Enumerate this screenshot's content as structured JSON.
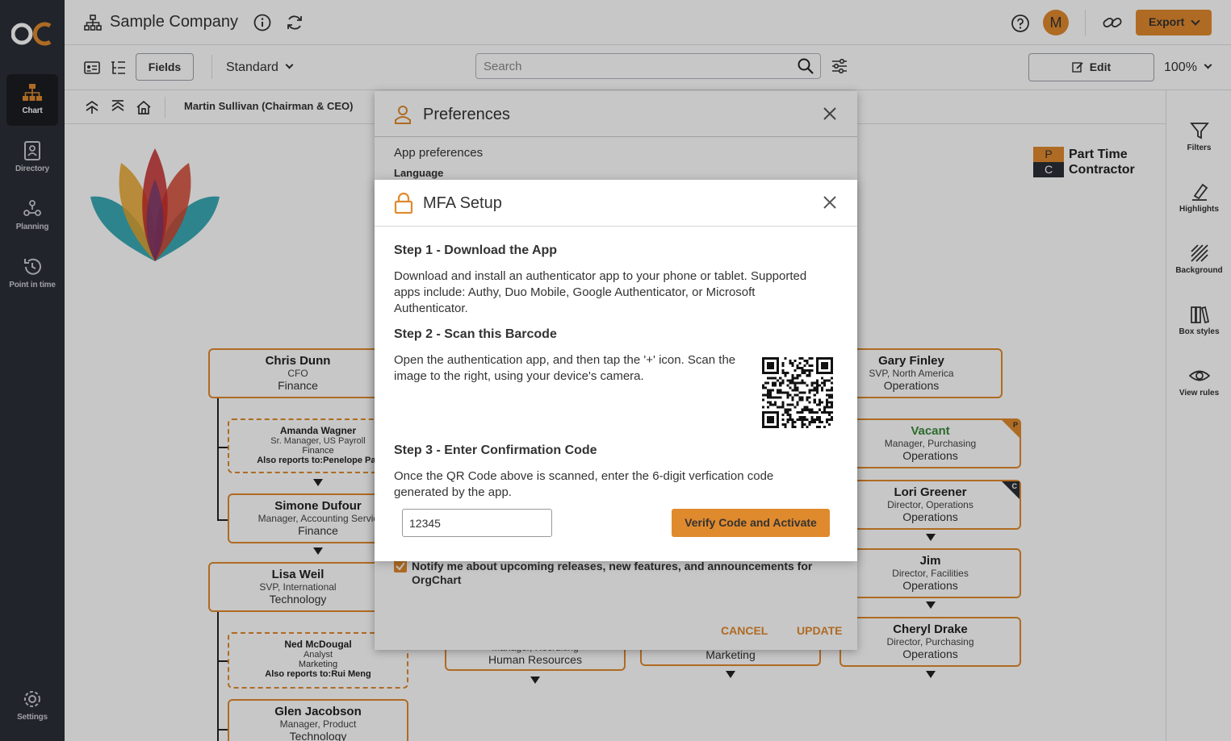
{
  "app": {
    "company": "Sample Company",
    "logo_text": "OC",
    "avatar_initial": "M",
    "export_label": "Export"
  },
  "leftnav": {
    "items": [
      {
        "label": "Chart",
        "icon": "org-chart-icon"
      },
      {
        "label": "Directory",
        "icon": "directory-icon"
      },
      {
        "label": "Planning",
        "icon": "planning-icon"
      },
      {
        "label": "Point in time",
        "icon": "history-icon"
      }
    ],
    "settings_label": "Settings"
  },
  "toolbar": {
    "fields_label": "Fields",
    "view_label": "Standard",
    "search_placeholder": "Search",
    "edit_label": "Edit",
    "zoom": "100%"
  },
  "breadcrumb": {
    "current": "Martin Sullivan (Chairman & CEO)"
  },
  "rightpanel": {
    "items": [
      {
        "label": "Filters",
        "icon": "filter-icon"
      },
      {
        "label": "Highlights",
        "icon": "highlighter-icon"
      },
      {
        "label": "Background",
        "icon": "background-icon"
      },
      {
        "label": "Box styles",
        "icon": "books-icon"
      },
      {
        "label": "View rules",
        "icon": "eye-icon"
      }
    ]
  },
  "legend": {
    "items": [
      {
        "key": "P",
        "label": "Part Time",
        "color": "#e08a2e"
      },
      {
        "key": "C",
        "label": "Contractor",
        "color": "#2b2f36"
      }
    ]
  },
  "chart": {
    "boxes": [
      {
        "name": "Chris  Dunn",
        "title": "CFO",
        "dept": "Finance"
      },
      {
        "name": "Amanda Wagner",
        "title": "Sr. Manager, US Payroll",
        "dept": "Finance",
        "also": "Also reports to:Penelope Par"
      },
      {
        "name": "Simone Dufour",
        "title": "Manager, Accounting Servic",
        "dept": "Finance"
      },
      {
        "name": "Lisa Weil",
        "title": "SVP, International",
        "dept": "Technology"
      },
      {
        "name": "Ned McDougal",
        "title": "Analyst",
        "dept": "Marketing",
        "also": "Also reports to:Rui Meng"
      },
      {
        "name": "Glen Jacobson",
        "title": "Manager, Product",
        "dept": "Technology"
      },
      {
        "name": "",
        "title": "Manager, Recruiting",
        "dept": "Human Resources"
      },
      {
        "name": "",
        "title": "",
        "dept": "Marketing"
      },
      {
        "name": "Gary Finley",
        "title": "SVP, North America",
        "dept": "Operations"
      },
      {
        "name": "Vacant",
        "title": "Manager, Purchasing",
        "dept": "Operations",
        "badge": "P"
      },
      {
        "name": "Lori Greener",
        "title": "Director, Operations",
        "dept": "Operations",
        "badge": "C"
      },
      {
        "name": "Jim",
        "title": "Director, Facilities",
        "dept": "Operations"
      },
      {
        "name": "Cheryl Drake",
        "title": "Director, Purchasing",
        "dept": "Operations"
      }
    ]
  },
  "preferences": {
    "title": "Preferences",
    "section": "App preferences",
    "language_label": "Language",
    "notify_label": "Notify me about upcoming releases, new features, and announcements for OrgChart",
    "notify_checked": true,
    "cancel_label": "CANCEL",
    "update_label": "UPDATE"
  },
  "mfa": {
    "title": "MFA Setup",
    "step1_title": "Step 1 - Download the App",
    "step1_text": "Download and install an authenticator app to your phone or tablet. Supported apps include: Authy, Duo Mobile, Google Authenticator, or Microsoft Authenticator.",
    "step2_title": "Step 2 - Scan this Barcode",
    "step2_text": "Open the authentication app, and then tap the '+' icon. Scan the image to the right, using your device's camera.",
    "step3_title": "Step 3 - Enter Confirmation Code",
    "step3_text": "Once the QR Code above is scanned, enter the 6-digit verfication code generated by the app.",
    "code_value": "12345",
    "verify_label": "Verify Code and Activate"
  },
  "colors": {
    "accent": "#e08a2e",
    "nav_bg": "#2b2f36",
    "vacant_green": "#3a8a3a"
  }
}
